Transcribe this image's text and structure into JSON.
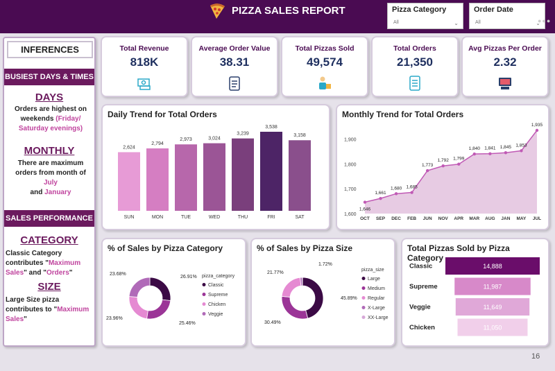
{
  "header": {
    "title": "PIZZA SALES REPORT",
    "slicers": [
      {
        "label": "Pizza Category",
        "value": "All"
      },
      {
        "label": "Order Date",
        "value": "All"
      }
    ],
    "colors": {
      "header_bg": "#4a0b52",
      "accent": "#6b1a5e",
      "highlight": "#c0449e"
    }
  },
  "inferences": {
    "title": "INFERENCES",
    "section1": "BUSIEST DAYS & TIMES",
    "days_heading": "DAYS",
    "days_l1": "Orders are highest on",
    "days_l2a": "weekends ",
    "days_l2b": "(Friday/",
    "days_l3": "Saturday evenings)",
    "monthly_heading": "MONTHLY",
    "monthly_l1": "There are maximum",
    "monthly_l2a": "orders from month of ",
    "monthly_l2b": "July",
    "monthly_l3a": "and ",
    "monthly_l3b": "January",
    "section2": "SALES PERFORMANCE",
    "category_heading": "CATEGORY",
    "cat_l1": "Classic Category",
    "cat_l2a": "contributes \"",
    "cat_l2b": "Maximum",
    "cat_l3a": "Sales",
    "cat_l3b": "\" and \"",
    "cat_l3c": "Orders",
    "cat_l3d": "\"",
    "size_heading": "SIZE",
    "size_l1": "Large Size pizza",
    "size_l2a": "contributes to \"",
    "size_l2b": "Maximum",
    "size_l3a": "Sales",
    "size_l3b": "\""
  },
  "kpis": [
    {
      "label": "Total Revenue",
      "value": "818K",
      "icon": "money-icon"
    },
    {
      "label": "Average Order Value",
      "value": "38.31",
      "icon": "clipboard-icon"
    },
    {
      "label": "Total Pizzas Sold",
      "value": "49,574",
      "icon": "delivery-person-icon"
    },
    {
      "label": "Total Orders",
      "value": "21,350",
      "icon": "order-list-icon"
    },
    {
      "label": "Avg Pizzas Per Order",
      "value": "2.32",
      "icon": "pos-terminal-icon"
    }
  ],
  "page_number": "16",
  "chart_data": [
    {
      "type": "bar",
      "title": "Daily Trend for Total Orders",
      "categories": [
        "SUN",
        "MON",
        "TUE",
        "WED",
        "THU",
        "FRI",
        "SAT"
      ],
      "values": [
        2624,
        2794,
        2973,
        3024,
        3239,
        3538,
        3158
      ],
      "labels": [
        "2,624",
        "2,794",
        "2,973",
        "3,024",
        "3,239",
        "3,538",
        "3,158"
      ],
      "colors": [
        "#e79bd6",
        "#d57ec2",
        "#b767ab",
        "#9b5596",
        "#7a3f7c",
        "#4d2466",
        "#8a4f8c"
      ]
    },
    {
      "type": "area",
      "title": "Monthly Trend for Total Orders",
      "categories": [
        "OCT",
        "SEP",
        "DEC",
        "FEB",
        "JUN",
        "NOV",
        "APR",
        "MAR",
        "AUG",
        "JAN",
        "MAY",
        "JUL"
      ],
      "values": [
        1646,
        1661,
        1680,
        1685,
        1773,
        1792,
        1799,
        1840,
        1841,
        1845,
        1853,
        1935
      ],
      "labels": [
        "1,646",
        "1,661",
        "1,680",
        "1,685",
        "1,773",
        "1,792",
        "1,799",
        "1,840",
        "1,841",
        "1,845",
        "1,853",
        "1,935"
      ],
      "yticks": [
        "1,900",
        "1,800",
        "1,700",
        "1,600"
      ],
      "ylim": [
        1600,
        1935
      ],
      "colors": {
        "line": "#c05ab5",
        "fill": "#e7cbe3"
      }
    },
    {
      "type": "pie",
      "title": "% of Sales by Pizza Category",
      "legend_title": "pizza_category",
      "categories": [
        "Classic",
        "Supreme",
        "Chicken",
        "Veggie"
      ],
      "values": [
        26.91,
        25.46,
        23.96,
        23.68
      ],
      "labels": [
        "26.91%",
        "25.46%",
        "23.96%",
        "23.68%"
      ],
      "colors": [
        "#3b0a45",
        "#9b3597",
        "#e58ad2",
        "#b06ab8"
      ]
    },
    {
      "type": "pie",
      "title": "% of Sales by Pizza Size",
      "legend_title": "pizza_size",
      "categories": [
        "Large",
        "Medium",
        "Regular",
        "X-Large",
        "XX-Large"
      ],
      "values": [
        45.89,
        30.49,
        21.77,
        1.72,
        0.13
      ],
      "labels": [
        "45.89%",
        "30.49%",
        "21.77%",
        "1.72%"
      ],
      "colors": [
        "#3b0a45",
        "#9b3597",
        "#e58ad2",
        "#b06ab8",
        "#d7a8d8"
      ]
    },
    {
      "type": "bar",
      "title": "Total Pizzas Sold by Pizza Category",
      "categories": [
        "Classic",
        "Supreme",
        "Veggie",
        "Chicken"
      ],
      "values": [
        14888,
        11987,
        11649,
        11050
      ],
      "labels": [
        "14,888",
        "11,987",
        "11,649",
        "11,050"
      ],
      "colors": [
        "#6a0d6a",
        "#d789c9",
        "#e0a8d8",
        "#f1cfea"
      ]
    }
  ]
}
